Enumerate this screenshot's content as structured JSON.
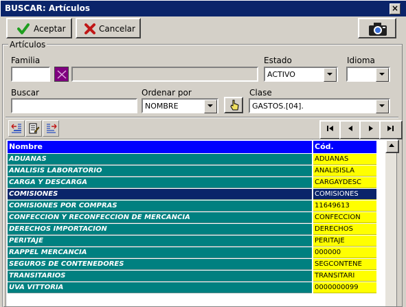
{
  "window": {
    "title": "BUSCAR: Artículos",
    "close_glyph": "×"
  },
  "toolbar": {
    "accept_label": "Aceptar",
    "cancel_label": "Cancelar",
    "camera_icon": "camera-icon"
  },
  "group": {
    "label": "Artículos"
  },
  "filters": {
    "familia_label": "Familia",
    "familia_code": "",
    "familia_desc": "",
    "estado_label": "Estado",
    "estado_value": "ACTIVO",
    "idioma_label": "Idioma",
    "idioma_value": "",
    "buscar_label": "Buscar",
    "buscar_value": "",
    "ordenar_label": "Ordenar por",
    "ordenar_value": "NOMBRE",
    "clase_label": "Clase",
    "clase_value": "GASTOS.[04]."
  },
  "nav": {
    "first": "⏮",
    "prev": "◀",
    "next": "▶",
    "last": "⏭"
  },
  "grid": {
    "columns": [
      "Nombre",
      "Cód."
    ],
    "rows": [
      {
        "name": "ADUANAS",
        "code": "ADUANAS"
      },
      {
        "name": "ANALISIS LABORATORIO",
        "code": "ANALISISLA"
      },
      {
        "name": "CARGA Y DESCARGA",
        "code": "CARGAYDESC"
      },
      {
        "name": "COMISIONES",
        "code": "COMISIONES"
      },
      {
        "name": "COMISIONES POR COMPRAS",
        "code": "11649613"
      },
      {
        "name": "CONFECCION Y RECONFECCION DE MERCANCIA",
        "code": "CONFECCION"
      },
      {
        "name": "DERECHOS IMPORTACION",
        "code": "DERECHOS"
      },
      {
        "name": "PERITAJE",
        "code": "PERITAJE"
      },
      {
        "name": "RAPPEL MERCANCIA",
        "code": "000000"
      },
      {
        "name": "SEGUROS DE CONTENEDORES",
        "code": "SEGCONTENE"
      },
      {
        "name": "TRANSITARIOS",
        "code": "TRANSITARI"
      },
      {
        "name": "UVA VITTORIA",
        "code": "0000000099"
      }
    ]
  },
  "colors": {
    "title_bar": "#0a246a",
    "header": "#0000ff",
    "name_cells": "#008080",
    "code_cells": "#ffff00",
    "selection": "#0a246a"
  }
}
